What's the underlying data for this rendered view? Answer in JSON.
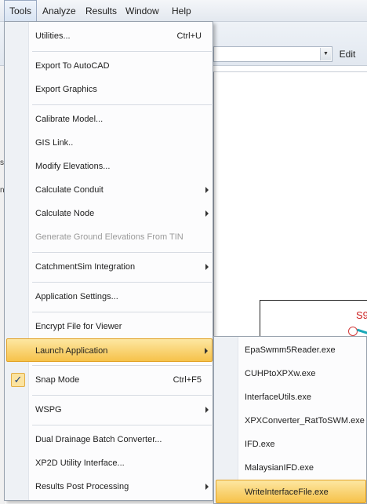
{
  "menubar": {
    "items": [
      "Tools",
      "Analyze",
      "Results",
      "Window",
      "Help"
    ],
    "active": "Tools"
  },
  "background": {
    "edit_label": "Edit",
    "canvas_label": "S9",
    "left_marks": [
      "s",
      "n"
    ]
  },
  "tools_menu": {
    "items": [
      {
        "label": "Utilities...",
        "shortcut": "Ctrl+U"
      },
      {
        "label": "Export To AutoCAD"
      },
      {
        "label": "Export Graphics"
      },
      {
        "label": "Calibrate Model..."
      },
      {
        "label": "GIS Link.."
      },
      {
        "label": "Modify Elevations..."
      },
      {
        "label": "Calculate Conduit"
      },
      {
        "label": "Calculate Node"
      },
      {
        "label": "Generate Ground Elevations From TIN",
        "disabled": true
      },
      {
        "label": "CatchmentSim Integration"
      },
      {
        "label": "Application Settings..."
      },
      {
        "label": "Encrypt File for Viewer"
      },
      {
        "label": "Launch Application",
        "highlighted": true
      },
      {
        "label": "Snap Mode",
        "shortcut": "Ctrl+F5",
        "checked": true
      },
      {
        "label": "WSPG"
      },
      {
        "label": "Dual Drainage Batch Converter..."
      },
      {
        "label": "XP2D Utility Interface..."
      },
      {
        "label": "Results Post Processing"
      }
    ],
    "check_glyph": "✓"
  },
  "launch_submenu": {
    "items": [
      {
        "label": "EpaSwmm5Reader.exe"
      },
      {
        "label": "CUHPtoXPXw.exe"
      },
      {
        "label": "InterfaceUtils.exe"
      },
      {
        "label": "XPXConverter_RatToSWM.exe"
      },
      {
        "label": "IFD.exe"
      },
      {
        "label": "MalaysianIFD.exe"
      },
      {
        "label": "WriteInterfaceFile.exe",
        "highlighted": true
      }
    ]
  }
}
